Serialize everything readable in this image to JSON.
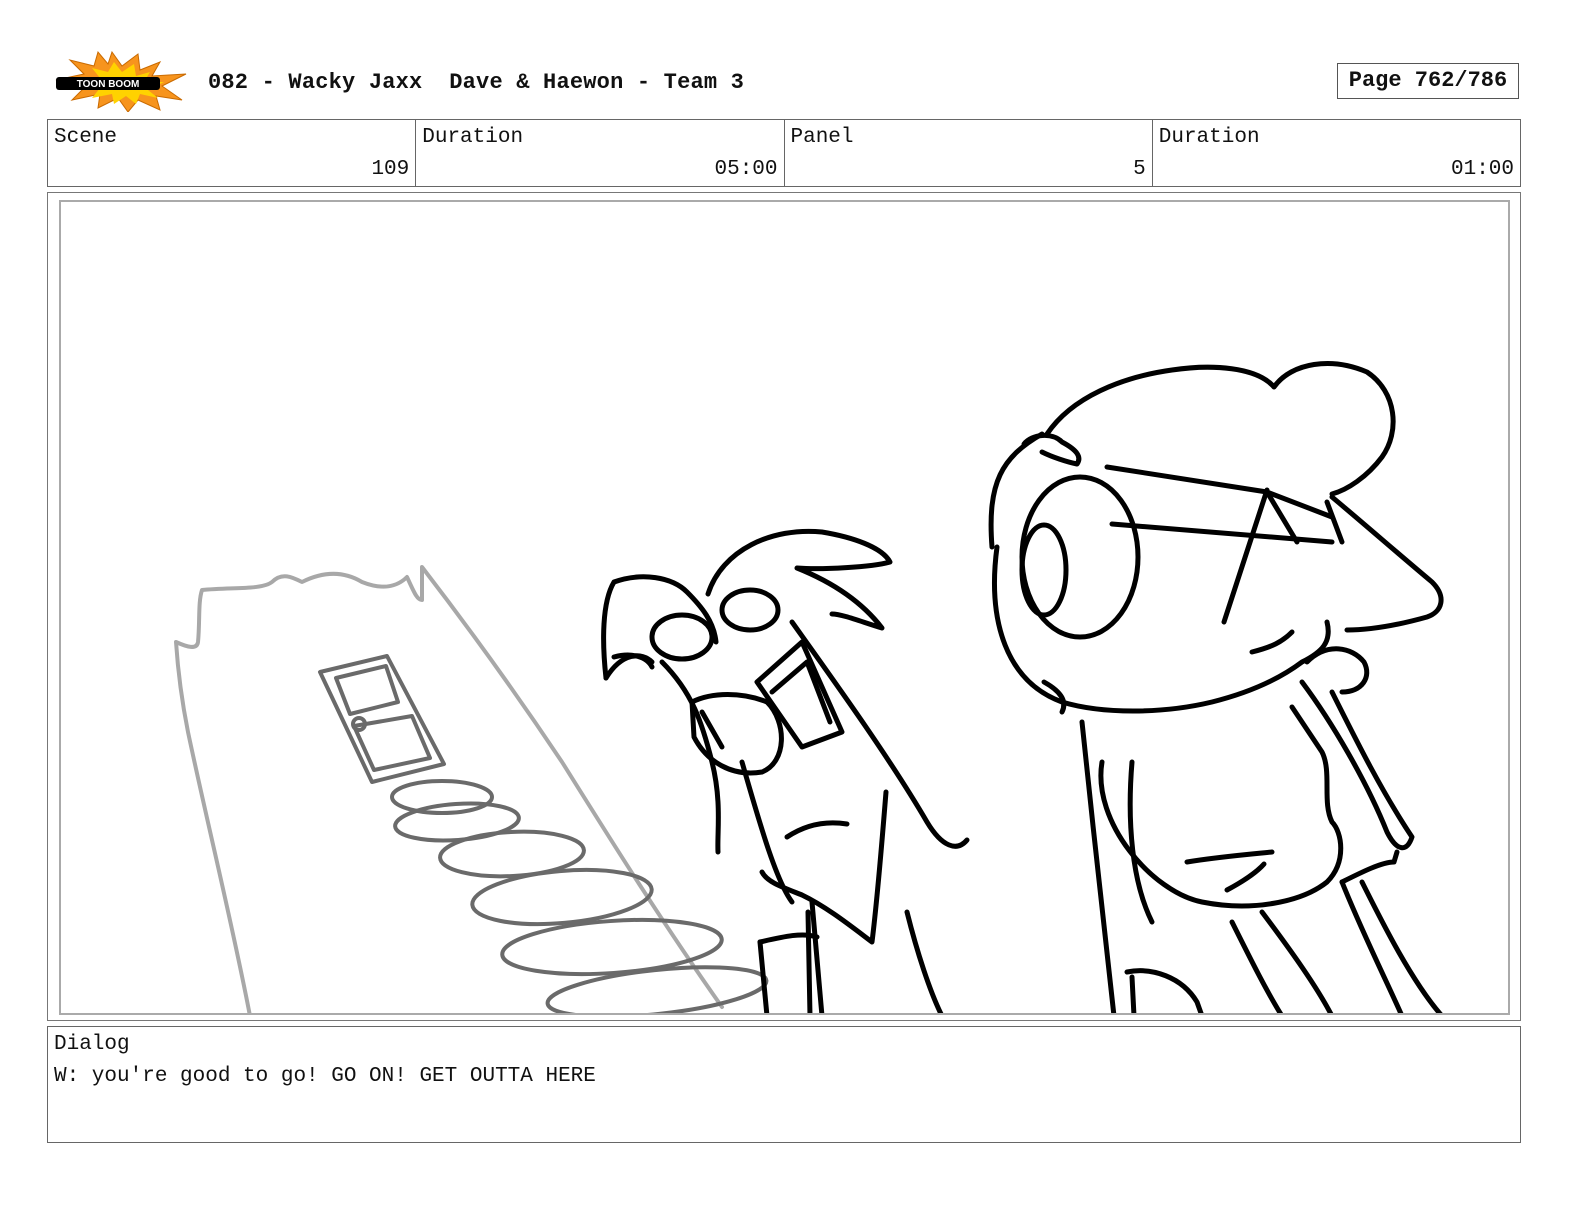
{
  "header": {
    "title": "082 - Wacky Jaxx  Dave & Haewon - Team 3",
    "page": "Page 762/786",
    "logo_text": "TOON BOOM",
    "logo_colors": {
      "burst": "#f7941d",
      "burst_inner": "#ffd200",
      "text": "#000000"
    }
  },
  "info": {
    "scene_label": "Scene",
    "scene_value": "109",
    "scene_duration_label": "Duration",
    "scene_duration_value": "05:00",
    "panel_label": "Panel",
    "panel_value": "5",
    "panel_duration_label": "Duration",
    "panel_duration_value": "01:00"
  },
  "dialog": {
    "label": "Dialog",
    "text": "W: you're good to go! GO ON! GET OUTTA HERE"
  },
  "colors": {
    "ink": "#000000",
    "pencil_grey": "#a8a8a8",
    "spiral_grey": "#6a6a6a"
  }
}
